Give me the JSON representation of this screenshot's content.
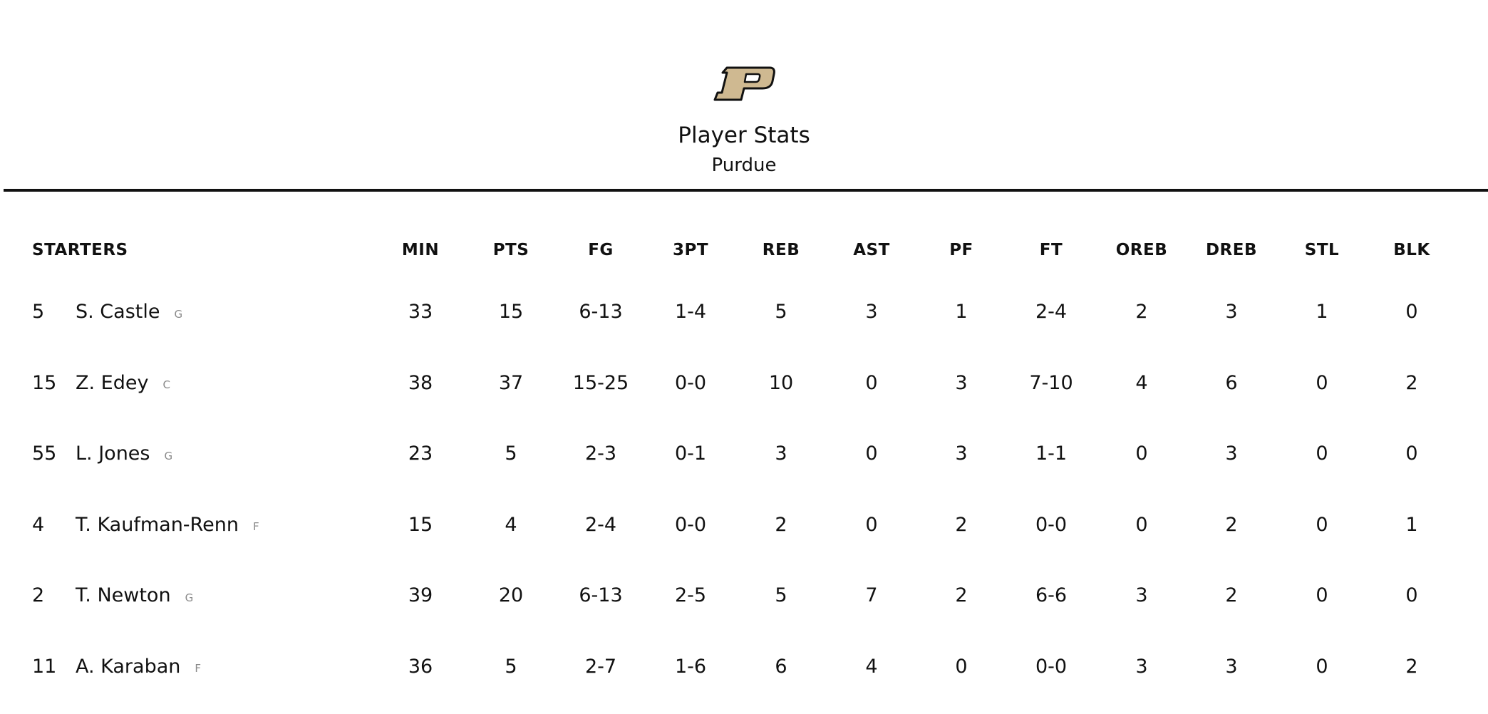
{
  "header": {
    "logo_icon": "purdue-p-logo",
    "logo_colors": {
      "fill": "#CFB991",
      "stroke": "#111111"
    },
    "title": "Player Stats",
    "subtitle": "Purdue"
  },
  "table": {
    "section_label": "STARTERS",
    "columns": [
      "MIN",
      "PTS",
      "FG",
      "3PT",
      "REB",
      "AST",
      "PF",
      "FT",
      "OREB",
      "DREB",
      "STL",
      "BLK"
    ],
    "rows": [
      {
        "number": "5",
        "name": "S. Castle",
        "pos": "G",
        "stats": [
          "33",
          "15",
          "6-13",
          "1-4",
          "5",
          "3",
          "1",
          "2-4",
          "2",
          "3",
          "1",
          "0"
        ]
      },
      {
        "number": "15",
        "name": "Z. Edey",
        "pos": "C",
        "stats": [
          "38",
          "37",
          "15-25",
          "0-0",
          "10",
          "0",
          "3",
          "7-10",
          "4",
          "6",
          "0",
          "2"
        ]
      },
      {
        "number": "55",
        "name": "L. Jones",
        "pos": "G",
        "stats": [
          "23",
          "5",
          "2-3",
          "0-1",
          "3",
          "0",
          "3",
          "1-1",
          "0",
          "3",
          "0",
          "0"
        ]
      },
      {
        "number": "4",
        "name": "T. Kaufman-Renn",
        "pos": "F",
        "stats": [
          "15",
          "4",
          "2-4",
          "0-0",
          "2",
          "0",
          "2",
          "0-0",
          "0",
          "2",
          "0",
          "1"
        ]
      },
      {
        "number": "2",
        "name": "T. Newton",
        "pos": "G",
        "stats": [
          "39",
          "20",
          "6-13",
          "2-5",
          "5",
          "7",
          "2",
          "6-6",
          "3",
          "2",
          "0",
          "0"
        ]
      },
      {
        "number": "11",
        "name": "A. Karaban",
        "pos": "F",
        "stats": [
          "36",
          "5",
          "2-7",
          "1-6",
          "6",
          "4",
          "0",
          "0-0",
          "3",
          "3",
          "0",
          "2"
        ]
      }
    ]
  }
}
